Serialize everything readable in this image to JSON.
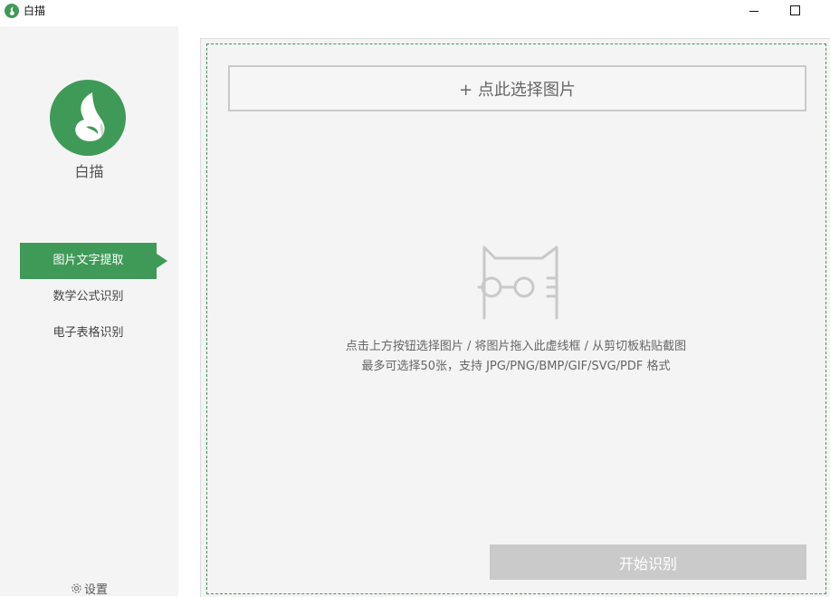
{
  "window": {
    "title": "白描"
  },
  "sidebar": {
    "brand": "白描",
    "nav": [
      {
        "label": "图片文字提取",
        "active": true
      },
      {
        "label": "数学公式识别",
        "active": false
      },
      {
        "label": "电子表格识别",
        "active": false
      }
    ],
    "settings_label": "设置"
  },
  "main": {
    "select_button": "+ 点此选择图片",
    "hint_line1": "点击上方按钮选择图片 / 将图片拖入此虚线框 / 从剪切板粘贴截图",
    "hint_line2": "最多可选择50张，支持 JPG/PNG/BMP/GIF/SVG/PDF 格式",
    "start_button": "开始识别"
  },
  "colors": {
    "accent": "#3f9a57",
    "sidebar_bg": "#f4f4f4",
    "button_disabled": "#cacaca"
  }
}
